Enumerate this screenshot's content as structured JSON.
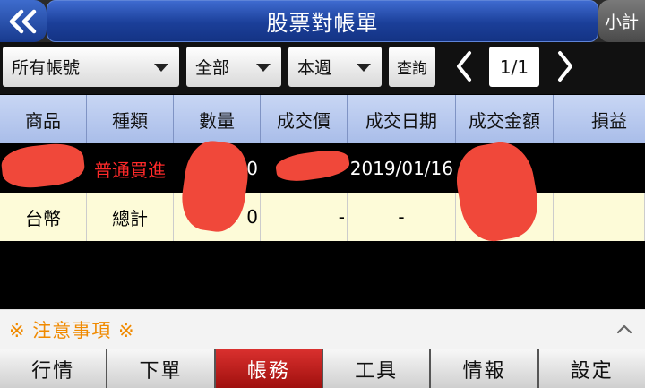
{
  "header": {
    "title": "股票對帳單",
    "right_button": "小計"
  },
  "toolbar": {
    "account_select": "所有帳號",
    "type_select": "全部",
    "period_select": "本週",
    "query_button": "查詢",
    "page_indicator": "1/1"
  },
  "table": {
    "columns": [
      "商品",
      "種類",
      "數量",
      "成交價",
      "成交日期",
      "成交金額",
      "損益"
    ],
    "rows": [
      {
        "product": "",
        "kind": "普通買進",
        "quantity": "0",
        "price": "",
        "date": "2019/01/16",
        "amount": "",
        "pnl": ""
      },
      {
        "product": "台幣",
        "kind": "總計",
        "quantity": "0",
        "price": "-",
        "date": "-",
        "amount": "",
        "pnl": ""
      }
    ]
  },
  "notice": {
    "label": "※ 注意事項 ※"
  },
  "tabs": [
    {
      "label": "行情",
      "active": false
    },
    {
      "label": "下單",
      "active": false
    },
    {
      "label": "帳務",
      "active": true
    },
    {
      "label": "工具",
      "active": false
    },
    {
      "label": "情報",
      "active": false
    },
    {
      "label": "設定",
      "active": false
    }
  ],
  "colors": {
    "header_blue": "#1b3f99",
    "accent_red": "#ff2a2a",
    "notice_orange": "#f08a00",
    "active_tab": "#c0201e",
    "table_header": "#b8c9ef",
    "total_row": "#fdfbd8"
  }
}
